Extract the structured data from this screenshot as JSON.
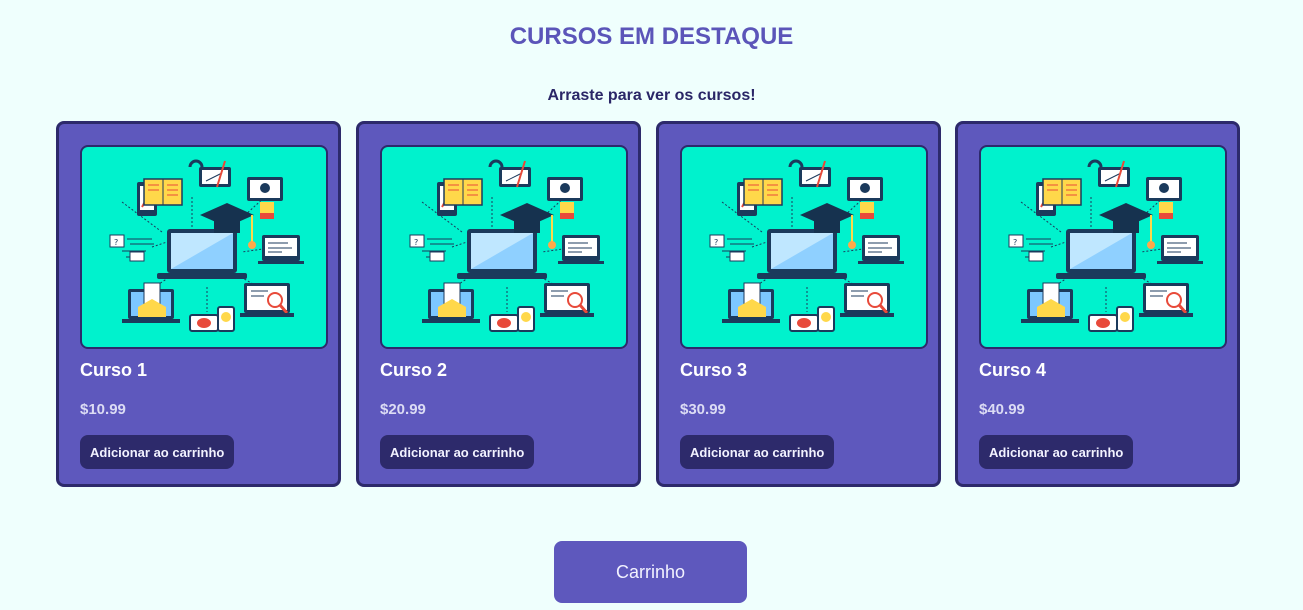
{
  "page": {
    "title": "CURSOS EM DESTAQUE",
    "subtitle": "Arraste para ver os cursos!"
  },
  "courses": [
    {
      "name": "Curso 1",
      "price": "$10.99",
      "button_label": "Adicionar ao carrinho"
    },
    {
      "name": "Curso 2",
      "price": "$20.99",
      "button_label": "Adicionar ao carrinho"
    },
    {
      "name": "Curso 3",
      "price": "$30.99",
      "button_label": "Adicionar ao carrinho"
    },
    {
      "name": "Curso 4",
      "price": "$40.99",
      "button_label": "Adicionar ao carrinho"
    }
  ],
  "cart": {
    "label": "Carrinho"
  },
  "colors": {
    "background": "#effffd",
    "accent": "#5e58bd",
    "dark": "#2d2a6b",
    "image_bg": "#00f2cd"
  },
  "icons": {
    "course_image": "e-learning-illustration"
  }
}
